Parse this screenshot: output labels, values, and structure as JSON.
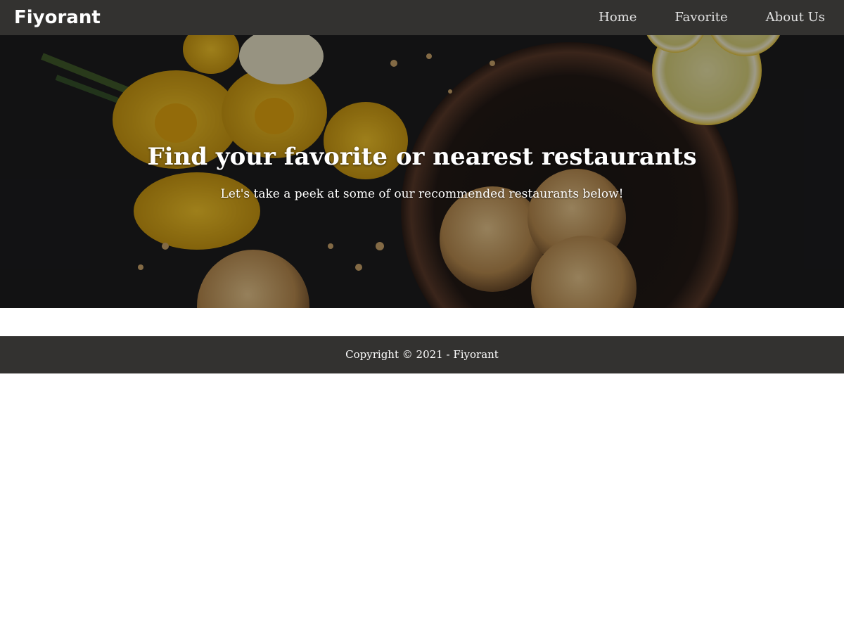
{
  "navbar": {
    "brand": "Fiyorant",
    "links": [
      {
        "label": "Home"
      },
      {
        "label": "Favorite"
      },
      {
        "label": "About Us"
      }
    ]
  },
  "hero": {
    "title": "Find your favorite or nearest restaurants",
    "subtitle": "Let's take a peek at some of our recommended restaurants below!"
  },
  "footer": {
    "copyright": "Copyright © 2021 - Fiyorant"
  },
  "colors": {
    "navbar_bg": "#333230",
    "footer_bg": "#333230",
    "hero_bg": "#161616",
    "text_light": "#ffffff"
  }
}
